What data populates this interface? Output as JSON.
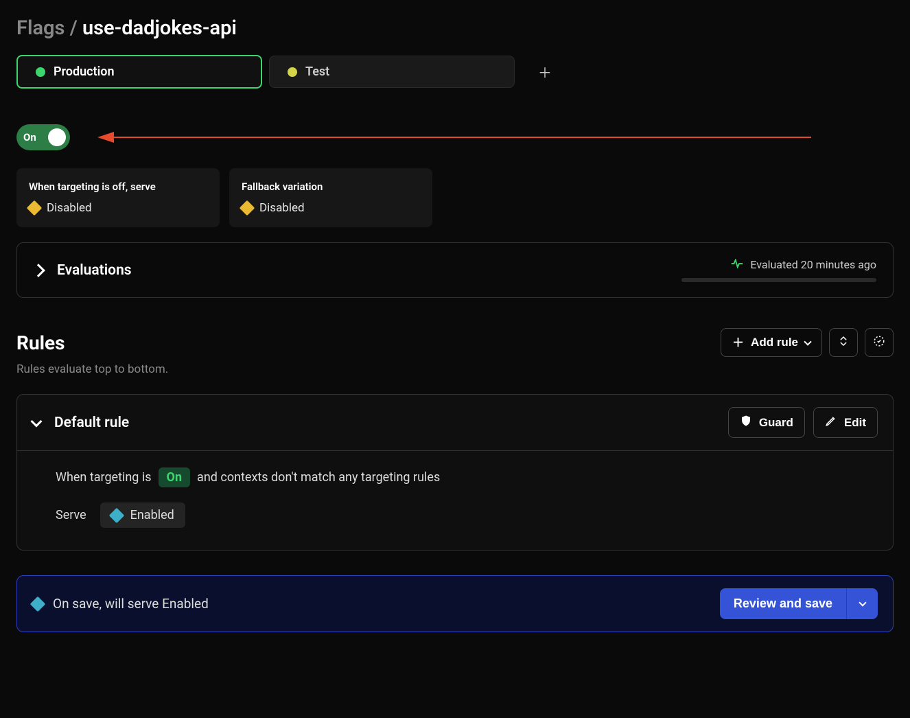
{
  "breadcrumb": {
    "root": "Flags",
    "sep": "/",
    "flag_name": "use-dadjokes-api"
  },
  "envs": [
    {
      "label": "Production",
      "dot": "green",
      "active": true
    },
    {
      "label": "Test",
      "dot": "yellow",
      "active": false
    }
  ],
  "toggle": {
    "label": "On",
    "state": "on"
  },
  "cards": {
    "off_serve": {
      "title": "When targeting is off, serve",
      "variation": "Disabled",
      "color": "gold"
    },
    "fallback": {
      "title": "Fallback variation",
      "variation": "Disabled",
      "color": "gold"
    }
  },
  "evaluations": {
    "title": "Evaluations",
    "status": "Evaluated 20 minutes ago"
  },
  "rules": {
    "heading": "Rules",
    "subtext": "Rules evaluate top to bottom.",
    "add_rule": "Add rule"
  },
  "default_rule": {
    "title": "Default rule",
    "guard_label": "Guard",
    "edit_label": "Edit",
    "when_prefix": "When targeting is",
    "on_label": "On",
    "when_suffix": "and contexts don't match any targeting rules",
    "serve_label": "Serve",
    "serve_variation": "Enabled",
    "serve_color": "teal"
  },
  "save": {
    "message": "On save, will serve Enabled",
    "button": "Review and save",
    "icon_color": "teal"
  }
}
